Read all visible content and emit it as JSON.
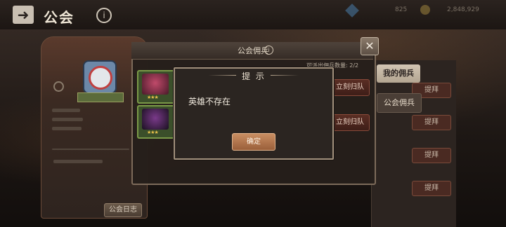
{
  "header": {
    "back_icon": "back-arrow-icon",
    "title": "公会",
    "info_icon": "info-icon",
    "gems": "825",
    "gold": "2,848,929"
  },
  "left_panel": {
    "log_button": "公会日志"
  },
  "side_tabs": {
    "my_mercenary": "我的佣兵",
    "guild_mercenary": "公会佣兵"
  },
  "background_list": {
    "promote_label": "提拜"
  },
  "mercenary_window": {
    "title": "公会佣兵",
    "dispatch_label": "可派出佣兵数量:",
    "dispatch_count": "2/2",
    "recall_label": "立刻归队",
    "star_text": "★★★"
  },
  "dialog": {
    "title": "提 示",
    "message": "英雄不存在",
    "confirm_label": "确定"
  }
}
